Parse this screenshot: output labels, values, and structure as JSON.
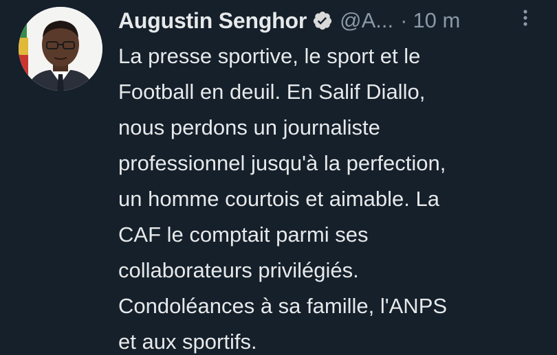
{
  "tweet": {
    "author_name": "Augustin Senghor",
    "handle": "@A...",
    "separator": "·",
    "time": "10 m",
    "text": "La presse sportive,  le sport et le\nFootball en deuil. En Salif Diallo,\nnous perdons un journaliste\nprofessionnel jusqu'à la perfection,\nun homme courtois et aimable. La\nCAF le comptait parmi ses\ncollaborateurs privilégiés.\nCondoléances à sa famille, l'ANPS\net aux sportifs."
  },
  "icons": {
    "verified": "verified-badge-icon",
    "more": "more-vertical-icon"
  },
  "colors": {
    "background": "#15202b",
    "primary_text": "#e7e9ea",
    "secondary_text": "#8b98a5"
  }
}
